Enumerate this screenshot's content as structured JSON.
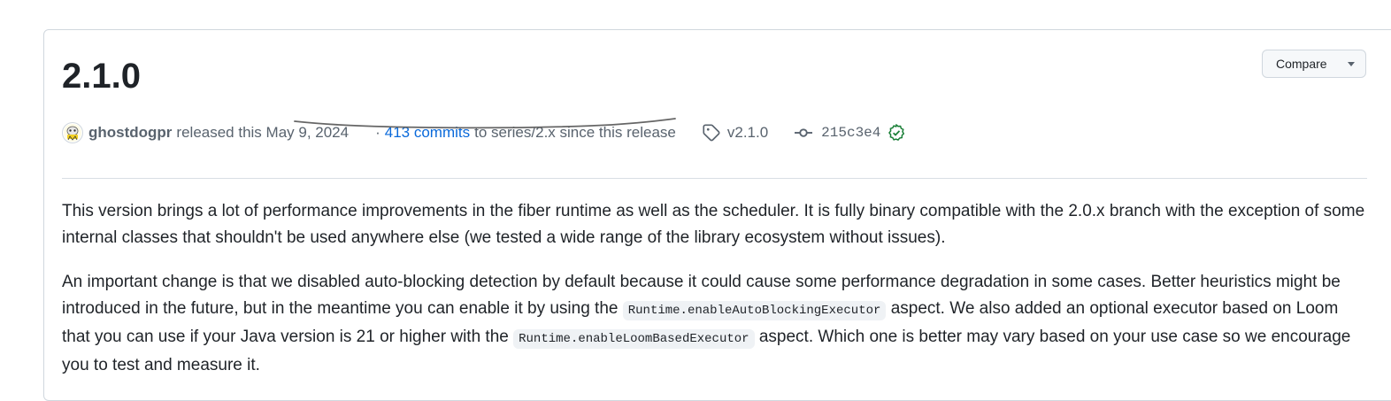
{
  "release": {
    "title": "2.1.0",
    "compare_label": "Compare",
    "author": "ghostdogpr",
    "released_text": "released this May 9, 2024",
    "commits_prefix": "·",
    "commits_link": "413 commits",
    "commits_suffix": "to series/2.x since this release",
    "tag": "v2.1.0",
    "commit_sha": "215c3e4",
    "verified_color": "#1a7f37"
  },
  "notes": {
    "paragraph1": "This version brings a lot of performance improvements in the fiber runtime as well as the scheduler. It is fully binary compatible with the 2.0.x branch with the exception of some internal classes that shouldn't be used anywhere else (we tested a wide range of the library ecosystem without issues).",
    "p2_part1": "An important change is that we disabled auto-blocking detection by default because it could cause some performance degradation in some cases. Better heuristics might be introduced in the future, but in the meantime you can enable it by using the",
    "p2_code1": "Runtime.enableAutoBlockingExecutor",
    "p2_part2": "aspect. We also added an optional executor based on Loom that you can use if your Java version is 21 or higher with the",
    "p2_code2": "Runtime.enableLoomBasedExecutor",
    "p2_part3": "aspect. Which one is better may vary based on your use case so we encourage you to test and measure it."
  },
  "icons": {
    "avatar": "avatar-icon",
    "tag": "tag-icon",
    "commit": "git-commit-icon",
    "verified": "verified-check-icon",
    "caret": "triangle-down-icon"
  }
}
